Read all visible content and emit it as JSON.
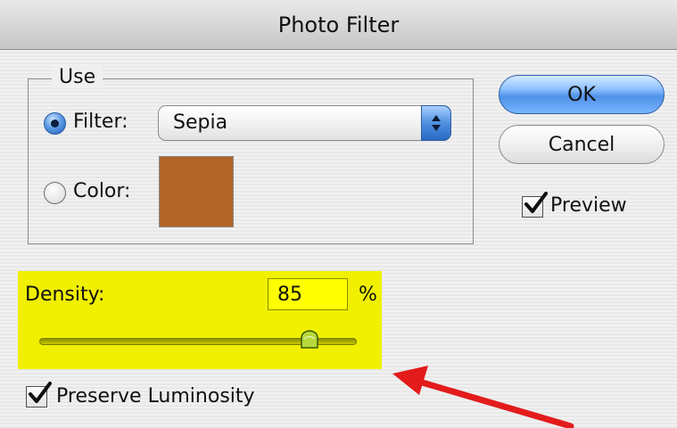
{
  "window": {
    "title": "Photo Filter"
  },
  "use_group": {
    "legend": "Use",
    "filter_option": {
      "label": "Filter:",
      "selected": true
    },
    "filter_select": {
      "value": "Sepia"
    },
    "color_option": {
      "label": "Color:",
      "selected": false
    },
    "color_swatch": {
      "color": "#B06428"
    }
  },
  "buttons": {
    "ok": "OK",
    "cancel": "Cancel"
  },
  "preview": {
    "label": "Preview",
    "checked": true
  },
  "density": {
    "label": "Density:",
    "value": "85",
    "unit": "%",
    "slider_percent": 85,
    "highlight_color": "#F0F000"
  },
  "preserve_luminosity": {
    "label": "Preserve Luminosity",
    "checked": true
  },
  "annotation": {
    "arrow_color": "#E31B1B"
  },
  "icons": {
    "radio_selected": "radio-selected-icon",
    "radio_unselected": "radio-unselected-icon",
    "select_arrows": "up-down-arrows-icon",
    "checkmark": "checkmark-icon",
    "slider_thumb": "slider-thumb-icon",
    "annotation_arrow": "red-arrow-icon"
  }
}
